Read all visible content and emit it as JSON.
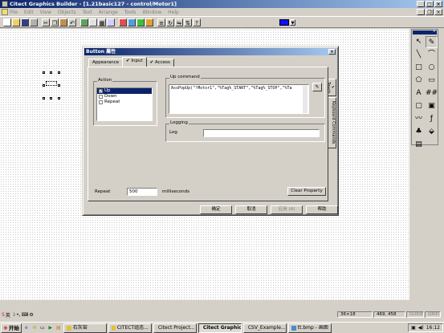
{
  "window": {
    "title": "Citect Graphics Builder - [1.21basic127 - control/Motor1]"
  },
  "menu": [
    "File",
    "Edit",
    "View",
    "Objects",
    "Text",
    "Arrange",
    "Tools",
    "Window",
    "Help"
  ],
  "colors": {
    "selected_color": "#1010ff",
    "titlebar": "#0a246a"
  },
  "toolbar_icons": [
    "new-icon",
    "open-icon",
    "save-icon",
    "print-icon",
    "cut-icon",
    "copy-icon",
    "paste-icon",
    "undo-icon",
    "library-icon",
    "pages-icon",
    "grid-icon",
    "zoom-icon",
    "group-icon",
    "ungroup-icon",
    "front-icon",
    "back-icon",
    "align-icon",
    "rotate-icon",
    "mirror-icon",
    "swap-icon",
    "help-icon"
  ],
  "tools_palette": {
    "items": [
      {
        "name": "pointer-tool-icon",
        "glyph": "↖"
      },
      {
        "name": "pen-tool-icon",
        "glyph": "✎"
      },
      {
        "name": "line-tool-icon",
        "glyph": "╲"
      },
      {
        "name": "polyline-tool-icon",
        "glyph": "⌒"
      },
      {
        "name": "rectangle-tool-icon",
        "glyph": "□"
      },
      {
        "name": "ellipse-tool-icon",
        "glyph": "○"
      },
      {
        "name": "polygon-tool-icon",
        "glyph": "⬠"
      },
      {
        "name": "pipe-tool-icon",
        "glyph": "▭"
      },
      {
        "name": "text-tool-icon",
        "glyph": "A"
      },
      {
        "name": "number-tool-icon",
        "glyph": "##"
      },
      {
        "name": "button-tool-icon",
        "glyph": "▢"
      },
      {
        "name": "symbol-set-tool-icon",
        "glyph": "▣"
      },
      {
        "name": "trend-tool-icon",
        "glyph": "〰"
      },
      {
        "name": "cicode-tool-icon",
        "glyph": "ƒ"
      },
      {
        "name": "genie-tool-icon",
        "glyph": "♣"
      },
      {
        "name": "bitmap-tool-icon",
        "glyph": "⬙"
      },
      {
        "name": "symbol-tool-icon",
        "glyph": "▤"
      }
    ]
  },
  "dialog": {
    "title": "Button 屬性",
    "close": "×",
    "tabs": [
      {
        "label": "Appearance",
        "check": ""
      },
      {
        "label": "Input",
        "check": "✔"
      },
      {
        "label": "Access",
        "check": "✔"
      }
    ],
    "side_tabs": [
      "Touch",
      "Keyboard Commands"
    ],
    "side_tab_check": "✔",
    "action": {
      "label": "Action",
      "items": [
        {
          "label": "Up",
          "checked": true,
          "selected": true
        },
        {
          "label": "Down",
          "checked": false,
          "selected": false
        },
        {
          "label": "Repeat",
          "checked": false,
          "selected": false
        }
      ]
    },
    "up_command": {
      "label": "Up command",
      "value": "AssPopUp(\"!Motor1\",\"%Tag%_START\",\"%Tag%_STOP\",\"%Ta"
    },
    "logging": {
      "label": "Logging",
      "log_label": "Log",
      "log_value": ""
    },
    "repeat": {
      "label": "Repeat",
      "value": "500",
      "unit": "milliseconds"
    },
    "clear_property": "Clear Property",
    "buttons": {
      "ok": "确定",
      "cancel": "取消",
      "apply": "应用 (A)",
      "help": "帮助"
    }
  },
  "statusbar": {
    "size": "36×18",
    "coords": "469, 458",
    "mode": "GUIDE",
    "grid": "GRID"
  },
  "ime": {
    "lang": "英"
  },
  "taskbar": {
    "start": "开始",
    "items": [
      {
        "label": "石灰窑",
        "active": false
      },
      {
        "label": "CITECT组态...",
        "active": false
      },
      {
        "label": "Citect Project...",
        "active": false
      },
      {
        "label": "Citect Graphic...",
        "active": true
      },
      {
        "label": "CSV_Example...",
        "active": false
      },
      {
        "label": "tt.bmp - 画图",
        "active": false
      }
    ],
    "clock": "16:12"
  }
}
